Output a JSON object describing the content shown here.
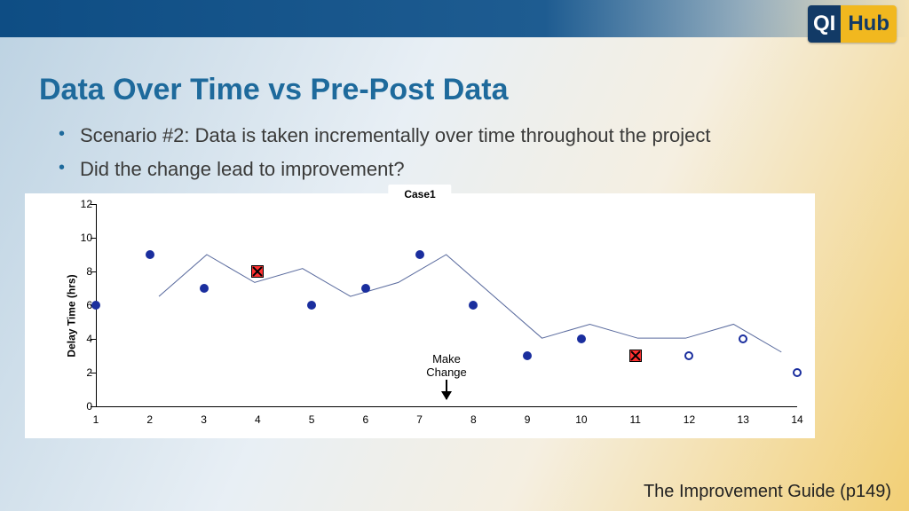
{
  "brand": {
    "left": "QI",
    "right": "Hub"
  },
  "title": "Data Over Time vs Pre-Post Data",
  "bullets": [
    "Scenario #2: Data is taken incrementally over time throughout the project",
    "Did the change lead to improvement?"
  ],
  "footer": "The Improvement Guide (p149)",
  "chart_data": {
    "type": "line",
    "title": "Case1",
    "ylabel": "Delay Time (hrs)",
    "xlabel": "",
    "ylim": [
      0,
      12
    ],
    "yticks": [
      0,
      2,
      4,
      6,
      8,
      10,
      12
    ],
    "categories": [
      1,
      2,
      3,
      4,
      5,
      6,
      7,
      8,
      9,
      10,
      11,
      12,
      13,
      14
    ],
    "values": [
      6,
      9,
      7,
      8,
      6,
      7,
      9,
      6,
      3,
      4,
      3,
      3,
      4,
      2
    ],
    "point_style": [
      "filled",
      "filled",
      "filled",
      "filled",
      "filled",
      "filled",
      "filled",
      "filled",
      "filled",
      "filled",
      "filled",
      "open",
      "open",
      "open"
    ],
    "highlight_squares": [
      {
        "x": 4,
        "y": 8
      },
      {
        "x": 11,
        "y": 3
      }
    ],
    "annotation": {
      "text": "Make\nChange",
      "between_x": [
        7,
        8
      ]
    }
  }
}
